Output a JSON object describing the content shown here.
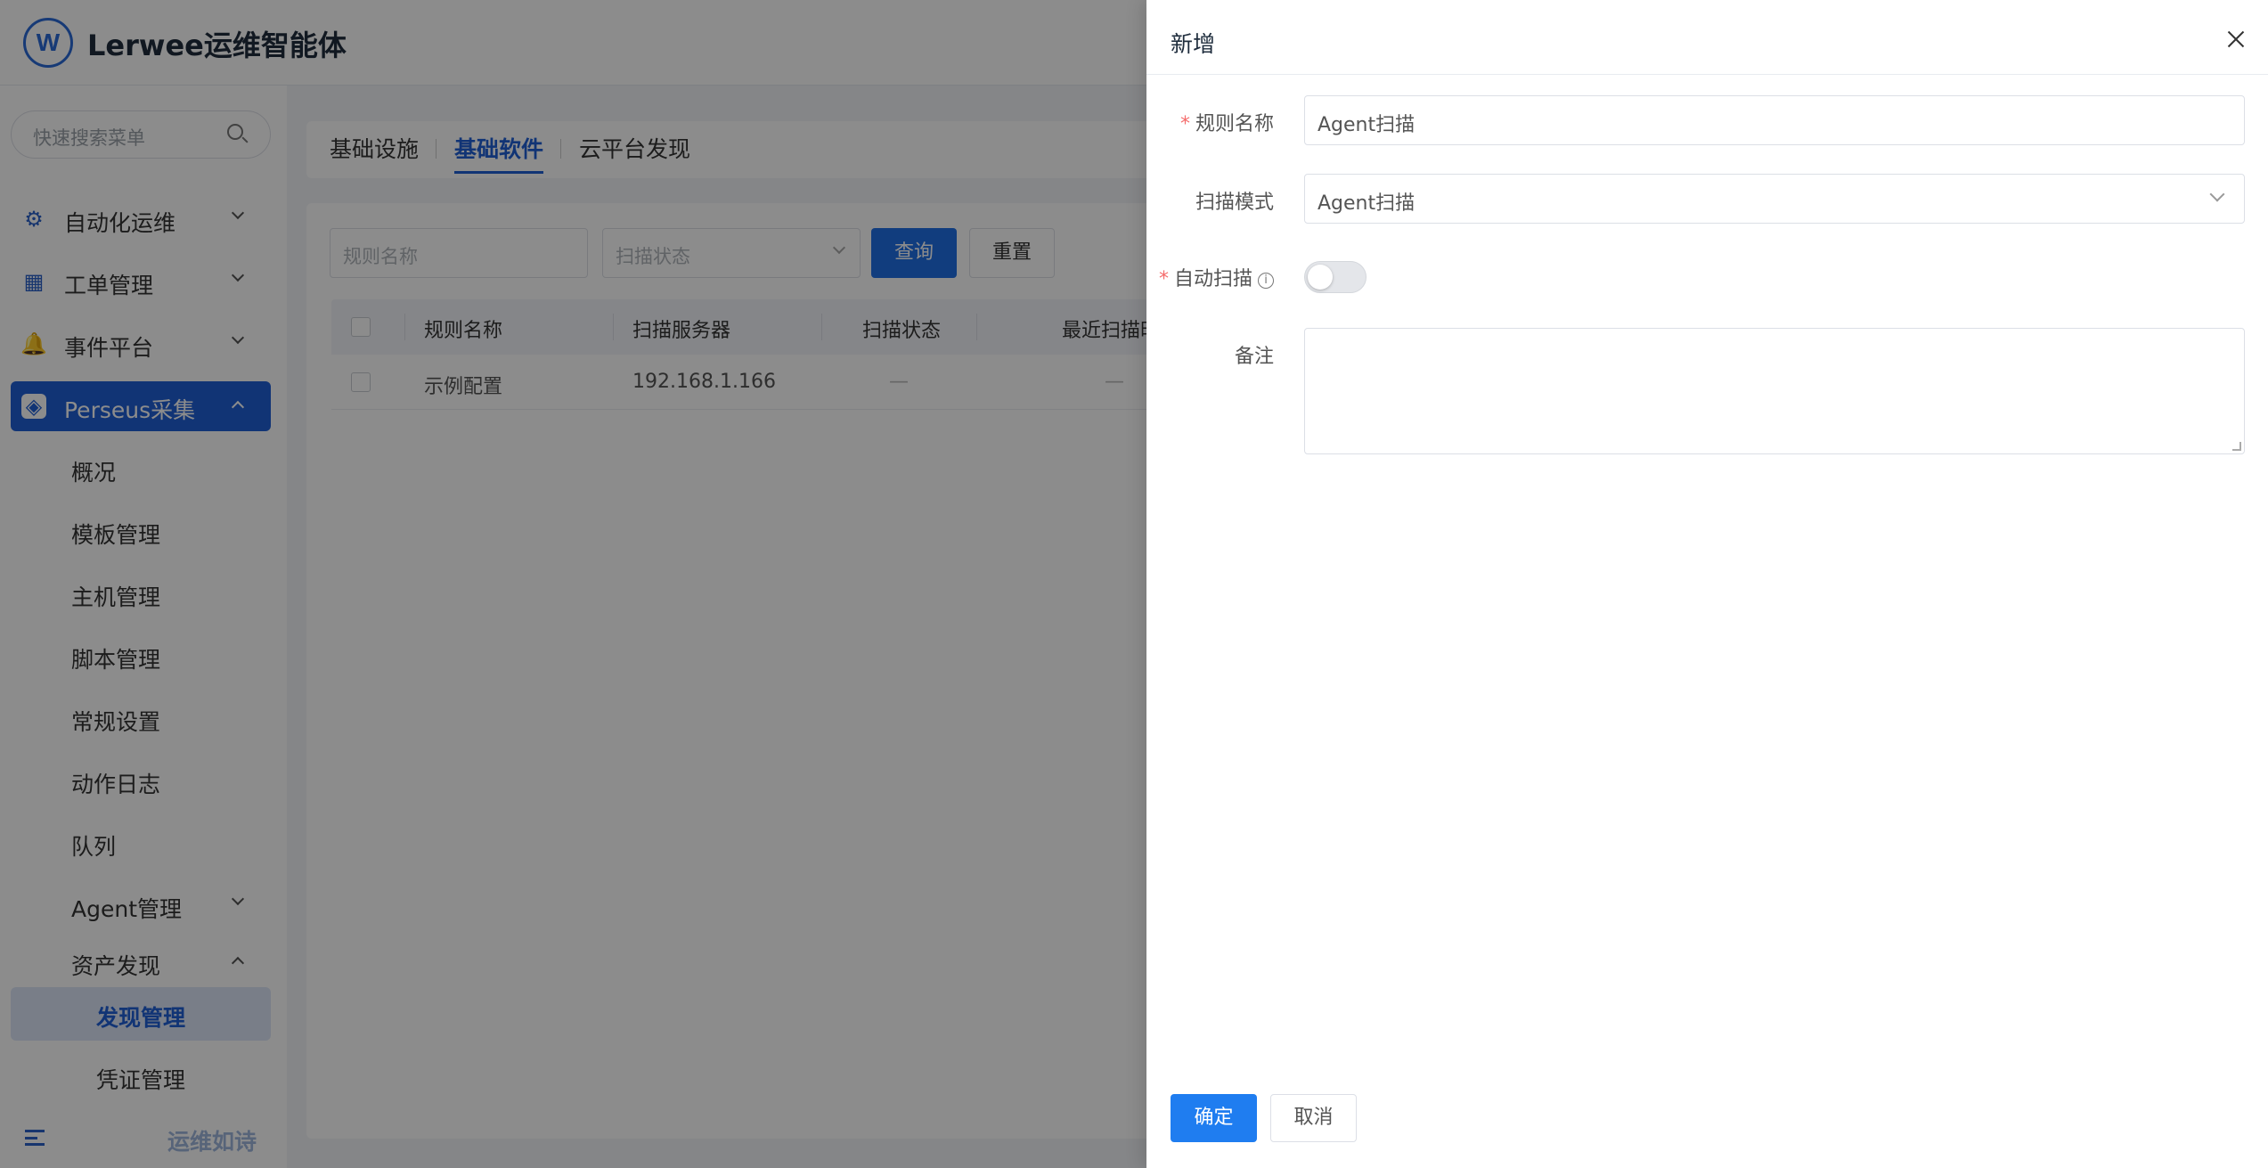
{
  "app": {
    "brand": "Lerwee运维智能体"
  },
  "sidebar": {
    "search_placeholder": "快速搜索菜单",
    "menu": [
      {
        "label": "自动化运维",
        "icon": "gear-icon"
      },
      {
        "label": "工单管理",
        "icon": "calendar-icon"
      },
      {
        "label": "事件平台",
        "icon": "bell-icon"
      },
      {
        "label": "Perseus采集",
        "icon": "perseus-icon"
      }
    ],
    "submenu": [
      "概况",
      "模板管理",
      "主机管理",
      "脚本管理",
      "常规设置",
      "动作日志",
      "队列",
      "Agent管理",
      "资产发现"
    ],
    "asset_children": [
      "发现管理",
      "凭证管理"
    ],
    "footer_text": "运维如诗"
  },
  "tabs": [
    "基础设施",
    "基础软件",
    "云平台发现"
  ],
  "filters": {
    "rule_name_placeholder": "规则名称",
    "scan_status_placeholder": "扫描状态",
    "query_label": "查询",
    "reset_label": "重置"
  },
  "table": {
    "columns": [
      "规则名称",
      "扫描服务器",
      "扫描状态",
      "最近扫描时"
    ],
    "rows": [
      {
        "name": "示例配置",
        "server": "192.168.1.166",
        "status": "—",
        "last": "—"
      }
    ]
  },
  "drawer": {
    "title": "新增",
    "fields": {
      "rule_name": {
        "label": "规则名称",
        "value": "Agent扫描",
        "required": true
      },
      "scan_mode": {
        "label": "扫描模式",
        "value": "Agent扫描"
      },
      "auto_scan": {
        "label": "自动扫描",
        "required": true,
        "enabled": false
      },
      "remark": {
        "label": "备注",
        "value": ""
      }
    },
    "confirm_label": "确定",
    "cancel_label": "取消"
  },
  "colors": {
    "primary": "#1f6fe6",
    "required": "#f56c6c",
    "sidebar_active": "#1f5fd6"
  }
}
